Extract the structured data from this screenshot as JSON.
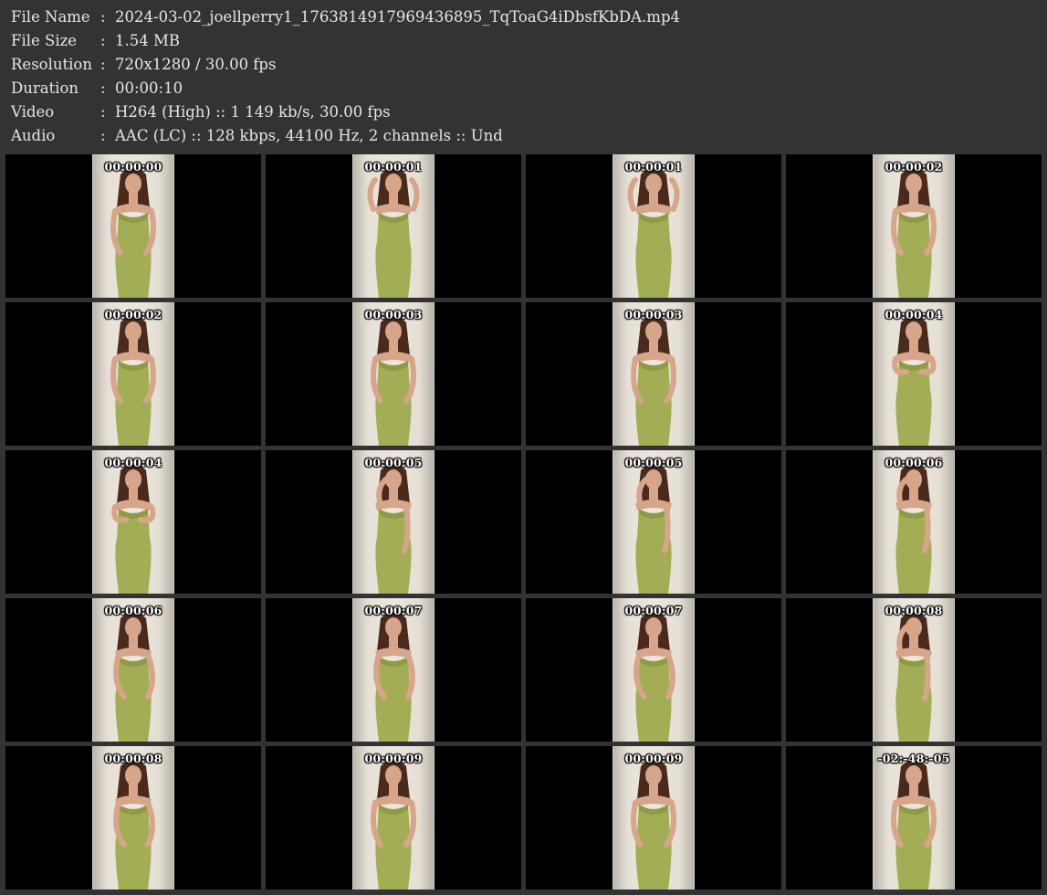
{
  "info": {
    "rows": [
      {
        "key": "File Name",
        "sep": ":",
        "value": "2024-03-02_joellperry1_1763814917969436895_TqToaG4iDbsfKbDA.mp4"
      },
      {
        "key": "File Size",
        "sep": ":",
        "value": "1.54 MB"
      },
      {
        "key": "Resolution",
        "sep": ":",
        "value": "720x1280 / 30.00 fps"
      },
      {
        "key": "Duration",
        "sep": ":",
        "value": "00:00:10"
      },
      {
        "key": "Video",
        "sep": ":",
        "value": "H264 (High) :: 1 149 kb/s, 30.00 fps"
      },
      {
        "key": "Audio",
        "sep": ":",
        "value": "AAC (LC) :: 128 kbps, 44100 Hz, 2 channels :: Und"
      }
    ]
  },
  "thumbnails": [
    {
      "timestamp": "00:00:00",
      "pose": "hip"
    },
    {
      "timestamp": "00:00:01",
      "pose": "hands-up"
    },
    {
      "timestamp": "00:00:01",
      "pose": "hands-up"
    },
    {
      "timestamp": "00:00:02",
      "pose": "hip"
    },
    {
      "timestamp": "00:00:02",
      "pose": "front"
    },
    {
      "timestamp": "00:00:03",
      "pose": "front"
    },
    {
      "timestamp": "00:00:03",
      "pose": "front"
    },
    {
      "timestamp": "00:00:04",
      "pose": "chest"
    },
    {
      "timestamp": "00:00:04",
      "pose": "chest"
    },
    {
      "timestamp": "00:00:05",
      "pose": "side"
    },
    {
      "timestamp": "00:00:05",
      "pose": "side"
    },
    {
      "timestamp": "00:00:06",
      "pose": "side-left"
    },
    {
      "timestamp": "00:00:06",
      "pose": "back"
    },
    {
      "timestamp": "00:00:07",
      "pose": "back"
    },
    {
      "timestamp": "00:00:07",
      "pose": "back"
    },
    {
      "timestamp": "00:00:08",
      "pose": "side-left"
    },
    {
      "timestamp": "00:00:08",
      "pose": "back"
    },
    {
      "timestamp": "00:00:09",
      "pose": "front"
    },
    {
      "timestamp": "00:00:09",
      "pose": "front"
    },
    {
      "timestamp": "-02:-48:-05",
      "pose": "front"
    }
  ],
  "colors": {
    "background": "#333333",
    "text": "#e6e6e6",
    "cell": "#000000",
    "wall": "#ece7de",
    "dress": "#a3ad55",
    "hair": "#4a2a1c",
    "skin": "#d6a58a"
  }
}
